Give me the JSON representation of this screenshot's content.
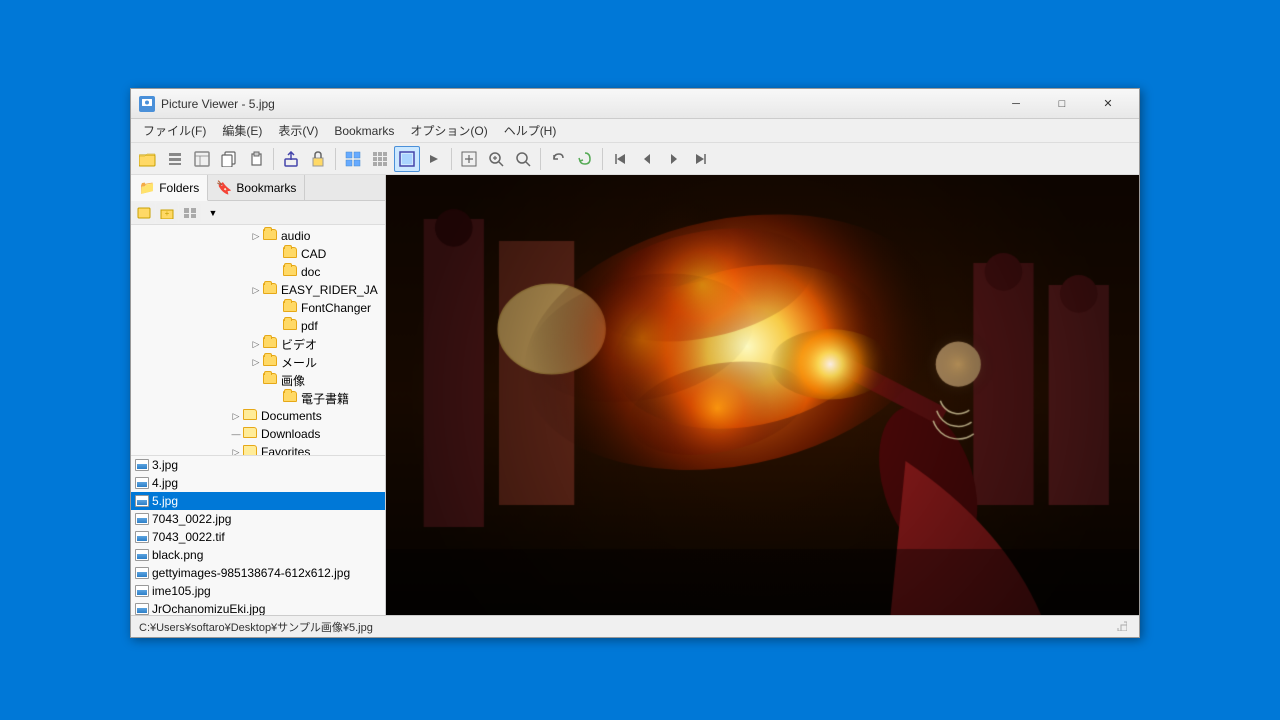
{
  "window": {
    "title": "Picture Viewer - 5.jpg",
    "icon_label": "PV"
  },
  "title_buttons": {
    "minimize": "─",
    "maximize": "□",
    "close": "✕"
  },
  "menu": {
    "items": [
      {
        "label": "ファイル(F)"
      },
      {
        "label": "編集(E)"
      },
      {
        "label": "表示(V)"
      },
      {
        "label": "Bookmarks"
      },
      {
        "label": "オプション(O)"
      },
      {
        "label": "ヘルプ(H)"
      }
    ]
  },
  "panel_tabs": {
    "folders": "Folders",
    "bookmarks": "Bookmarks"
  },
  "tree": {
    "items": [
      {
        "indent": 120,
        "expanded": false,
        "label": "audio"
      },
      {
        "indent": 140,
        "expanded": false,
        "label": "CAD"
      },
      {
        "indent": 140,
        "expanded": false,
        "label": "doc"
      },
      {
        "indent": 120,
        "expanded": false,
        "label": "EASY_RIDER_JA"
      },
      {
        "indent": 140,
        "expanded": false,
        "label": "FontChanger"
      },
      {
        "indent": 140,
        "expanded": false,
        "label": "pdf"
      },
      {
        "indent": 120,
        "expanded": false,
        "label": "ビデオ"
      },
      {
        "indent": 120,
        "expanded": false,
        "label": "メール"
      },
      {
        "indent": 120,
        "expanded": false,
        "label": "画像"
      },
      {
        "indent": 140,
        "expanded": false,
        "label": "電子書籍"
      },
      {
        "indent": 100,
        "expanded": false,
        "label": "Documents"
      },
      {
        "indent": 100,
        "expanded": false,
        "label": "Downloads"
      },
      {
        "indent": 100,
        "expanded": false,
        "label": "Favorites"
      }
    ]
  },
  "file_list": {
    "items": [
      {
        "name": "3.jpg",
        "selected": false
      },
      {
        "name": "4.jpg",
        "selected": false
      },
      {
        "name": "5.jpg",
        "selected": true
      },
      {
        "name": "7043_0022.jpg",
        "selected": false
      },
      {
        "name": "7043_0022.tif",
        "selected": false
      },
      {
        "name": "black.png",
        "selected": false
      },
      {
        "name": "gettyimages-985138674-612x612.jpg",
        "selected": false
      },
      {
        "name": "ime105.jpg",
        "selected": false
      },
      {
        "name": "JrOchanomizuEki.jpg",
        "selected": false
      }
    ]
  },
  "status_bar": {
    "path": "C:¥Users¥softaro¥Desktop¥サンプル画像¥5.jpg"
  }
}
